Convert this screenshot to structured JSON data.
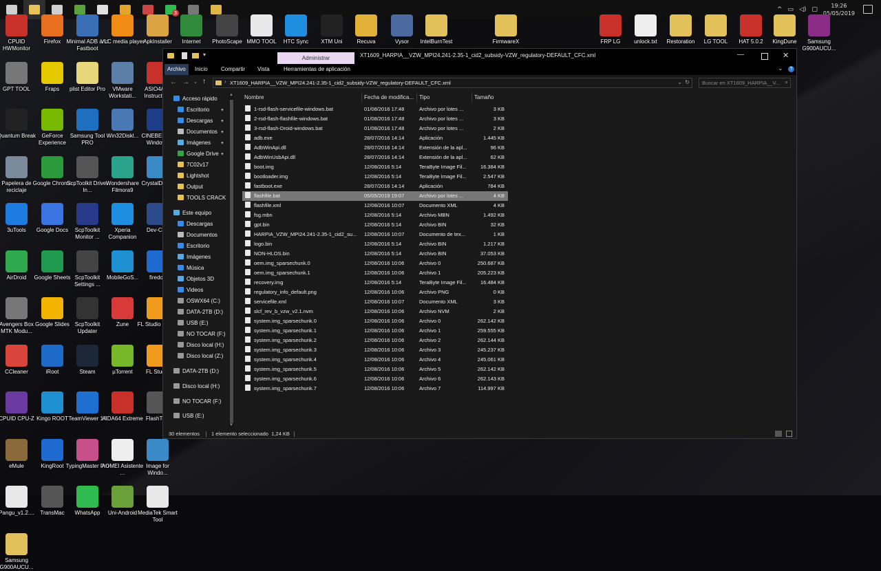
{
  "taskbar": {
    "time": "19:26",
    "date": "05/05/2019",
    "buttons": [
      {
        "icon": "windows-icon",
        "color": "#cfcfcf"
      },
      {
        "icon": "file-explorer-icon",
        "color": "#e8c25a"
      },
      {
        "icon": "store-icon",
        "color": "#cfcfcf"
      },
      {
        "icon": "app-green-icon",
        "color": "#5aa33c"
      },
      {
        "icon": "mail-icon",
        "color": "#e0e0e0"
      },
      {
        "icon": "chrome-icon",
        "color": "#e3a52b"
      },
      {
        "icon": "app-icon",
        "color": "#c44"
      },
      {
        "icon": "whatsapp-icon",
        "color": "#2fbb4f"
      },
      {
        "icon": "app-icon",
        "color": "#777"
      },
      {
        "icon": "app-icon",
        "color": "#e2b646"
      }
    ],
    "notification_badge": "3"
  },
  "desktop_icons": [
    {
      "label": "CPUID HWMonitor",
      "color": "#c8302a"
    },
    {
      "label": "Firefox",
      "color": "#e76f1e"
    },
    {
      "label": "Minimal ADB and Fastboot",
      "color": "#3b6fb5"
    },
    {
      "label": "VLC media player",
      "color": "#f08c14"
    },
    {
      "label": "ApkInstaller",
      "color": "#d9a441"
    },
    {
      "label": "Internet",
      "color": "#2f8a3c"
    },
    {
      "label": "PhotoScape",
      "color": "#444"
    },
    {
      "label": "MMO TOOL",
      "color": "#e8e8e8"
    },
    {
      "label": "HTC Sync",
      "color": "#1e8fe0"
    },
    {
      "label": "XTM Uni",
      "color": "#222"
    },
    {
      "label": "Recuva",
      "color": "#e2b13a"
    },
    {
      "label": "Vysor",
      "color": "#4a6aa0"
    },
    {
      "label": "IntelBurnTest",
      "color": "#e2c15a"
    },
    {
      "label": "FirmwareX",
      "color": "#e2c15a"
    },
    {
      "label": "FRP LG",
      "color": "#c8302a"
    },
    {
      "label": "unlock.txt",
      "color": "#eeeeee"
    },
    {
      "label": "Restoration",
      "color": "#e2c15a"
    },
    {
      "label": "LG TOOL",
      "color": "#e2c15a"
    },
    {
      "label": "HAT 5.0.2",
      "color": "#c8302a"
    },
    {
      "label": "KingDune",
      "color": "#e2c15a"
    },
    {
      "label": "Samsung G900AUCU...",
      "color": "#8b2d86"
    },
    {
      "label": "GPT TOOL",
      "color": "#777"
    },
    {
      "label": "Fraps",
      "color": "#e6c800"
    },
    {
      "label": "plist Editor Pro",
      "color": "#e8d77a"
    },
    {
      "label": "VMware Workstati...",
      "color": "#5b7fa6"
    },
    {
      "label": "ASIO4ALL Instructio...",
      "color": "#c8302a"
    },
    {
      "label": "Quantum Break",
      "color": "#222"
    },
    {
      "label": "GeForce Experience",
      "color": "#76b900"
    },
    {
      "label": "Samsung Tool PRO",
      "color": "#1e6fc0"
    },
    {
      "label": "Win32Diskl...",
      "color": "#4a78b5"
    },
    {
      "label": "CINEBENCH Windows",
      "color": "#1d3e86"
    },
    {
      "label": "Papelera de reciclaje",
      "color": "#7a8a9a"
    },
    {
      "label": "Google Chrome",
      "color": "#2a9a3c"
    },
    {
      "label": "ScpToolkit Driver In...",
      "color": "#555"
    },
    {
      "label": "Wondershare Filmora9",
      "color": "#2aa38a"
    },
    {
      "label": "CrystalDisk 6",
      "color": "#3a8ac8"
    },
    {
      "label": "3uTools",
      "color": "#1e7be0"
    },
    {
      "label": "Google Docs",
      "color": "#3a74e0"
    },
    {
      "label": "ScpToolkit Monitor ...",
      "color": "#2a3a8a"
    },
    {
      "label": "Xperia Companion",
      "color": "#1e8fe0"
    },
    {
      "label": "Dev-C++",
      "color": "#2a4a8a"
    },
    {
      "label": "AirDroid",
      "color": "#2fa84f"
    },
    {
      "label": "Google Sheets",
      "color": "#1f9a4e"
    },
    {
      "label": "ScpToolkit Settings ...",
      "color": "#444"
    },
    {
      "label": "MobileGoS...",
      "color": "#1e8fd0"
    },
    {
      "label": "firedoc",
      "color": "#1e6ad0"
    },
    {
      "label": "Avengers Box MTK Modu...",
      "color": "#777"
    },
    {
      "label": "Google Slides",
      "color": "#f2b400"
    },
    {
      "label": "ScpToolkit Updater",
      "color": "#333"
    },
    {
      "label": "Zune",
      "color": "#d83a3a"
    },
    {
      "label": "FL Studio (64bit)",
      "color": "#f09a1e"
    },
    {
      "label": "CCleaner",
      "color": "#d8453a"
    },
    {
      "label": "iRoot",
      "color": "#1e6ac8"
    },
    {
      "label": "Steam",
      "color": "#1b2838"
    },
    {
      "label": "µTorrent",
      "color": "#76b82a"
    },
    {
      "label": "FL Studio",
      "color": "#f09a1e"
    },
    {
      "label": "CPUID CPU-Z",
      "color": "#6a3aa0"
    },
    {
      "label": "Kingo ROOT",
      "color": "#1e8fd0"
    },
    {
      "label": "TeamViewer 14",
      "color": "#1e6fd0"
    },
    {
      "label": "AIDA64 Extreme",
      "color": "#c8302a"
    },
    {
      "label": "FlashTool",
      "color": "#555"
    },
    {
      "label": "eMule",
      "color": "#8a6a3a"
    },
    {
      "label": "KingRoot",
      "color": "#1e6ad0"
    },
    {
      "label": "TypingMaster Pro",
      "color": "#c8508a"
    },
    {
      "label": "AOMEI Asistente ...",
      "color": "#eeeeee"
    },
    {
      "label": "Image for Windo...",
      "color": "#3a8ac8"
    },
    {
      "label": "Pangu_v1.2....",
      "color": "#e8e8e8"
    },
    {
      "label": "TransMac",
      "color": "#555"
    },
    {
      "label": "WhatsApp",
      "color": "#2fbb4f"
    },
    {
      "label": "Uni-Android",
      "color": "#6aa03a"
    },
    {
      "label": "MediaTek Smart Tool",
      "color": "#e8e8e8"
    },
    {
      "label": "Samsung G900AUCU...",
      "color": "#e2c15a"
    }
  ],
  "explorer": {
    "title": "XT1609_HARPIA__VZW_MPI24.241-2.35-1_cid2_subsidy-VZW_regulatory-DEFAULT_CFC.xml",
    "context_tab": "Administrar",
    "ribbon_tabs": [
      "Archivo",
      "Inicio",
      "Compartir",
      "Vista",
      "Herramientas de aplicación"
    ],
    "address": "XT1609_HARPIA__VZW_MPI24.241-2.35-1_cid2_subsidy-VZW_regulatory-DEFAULT_CFC.xml",
    "search_placeholder": "Buscar en XT1609_HARPIA__V...",
    "nav_items": [
      {
        "label": "Acceso rápido",
        "indent": 0,
        "pin": false,
        "icon": "star-icon",
        "color": "#3a8ae0"
      },
      {
        "label": "Escritorio",
        "indent": 1,
        "pin": true,
        "icon": "desktop-icon",
        "color": "#3a8ae0"
      },
      {
        "label": "Descargas",
        "indent": 1,
        "pin": true,
        "icon": "download-icon",
        "color": "#3a8ae0"
      },
      {
        "label": "Documentos",
        "indent": 1,
        "pin": true,
        "icon": "documents-icon",
        "color": "#bbbbbb"
      },
      {
        "label": "Imágenes",
        "indent": 1,
        "pin": true,
        "icon": "pictures-icon",
        "color": "#5aaae0"
      },
      {
        "label": "Google Drive",
        "indent": 1,
        "pin": true,
        "icon": "drive-icon",
        "color": "#3aa04a"
      },
      {
        "label": "7C02v17",
        "indent": 1,
        "pin": false,
        "icon": "folder-icon",
        "color": "#e2c15a"
      },
      {
        "label": "Lightshot",
        "indent": 1,
        "pin": false,
        "icon": "folder-icon",
        "color": "#e2c15a"
      },
      {
        "label": "Output",
        "indent": 1,
        "pin": false,
        "icon": "folder-icon",
        "color": "#e2c15a"
      },
      {
        "label": "TOOLS CRACK",
        "indent": 1,
        "pin": false,
        "icon": "folder-icon",
        "color": "#e2c15a"
      },
      {
        "label": "Este equipo",
        "indent": 0,
        "pin": false,
        "icon": "computer-icon",
        "color": "#5aaae0"
      },
      {
        "label": "Descargas",
        "indent": 1,
        "pin": false,
        "icon": "download-icon",
        "color": "#3a8ae0"
      },
      {
        "label": "Documentos",
        "indent": 1,
        "pin": false,
        "icon": "documents-icon",
        "color": "#bbbbbb"
      },
      {
        "label": "Escritorio",
        "indent": 1,
        "pin": false,
        "icon": "desktop-icon",
        "color": "#3a8ae0"
      },
      {
        "label": "Imágenes",
        "indent": 1,
        "pin": false,
        "icon": "pictures-icon",
        "color": "#5aaae0"
      },
      {
        "label": "Música",
        "indent": 1,
        "pin": false,
        "icon": "music-icon",
        "color": "#3a8ae0"
      },
      {
        "label": "Objetos 3D",
        "indent": 1,
        "pin": false,
        "icon": "objects-3d-icon",
        "color": "#5aaae0"
      },
      {
        "label": "Videos",
        "indent": 1,
        "pin": false,
        "icon": "videos-icon",
        "color": "#3a8ae0"
      },
      {
        "label": "OSWX64 (C:)",
        "indent": 1,
        "pin": false,
        "icon": "drive-icon",
        "color": "#999999"
      },
      {
        "label": "DATA-2TB (D:)",
        "indent": 1,
        "pin": false,
        "icon": "drive-icon",
        "color": "#999999"
      },
      {
        "label": "USB (E:)",
        "indent": 1,
        "pin": false,
        "icon": "drive-icon",
        "color": "#999999"
      },
      {
        "label": "NO TOCAR (F:)",
        "indent": 1,
        "pin": false,
        "icon": "drive-icon",
        "color": "#999999"
      },
      {
        "label": "Disco local (H:)",
        "indent": 1,
        "pin": false,
        "icon": "drive-icon",
        "color": "#999999"
      },
      {
        "label": "Disco local (Z:)",
        "indent": 1,
        "pin": false,
        "icon": "drive-icon",
        "color": "#999999"
      },
      {
        "label": "DATA-2TB (D:)",
        "indent": 0,
        "pin": false,
        "icon": "drive-icon",
        "color": "#999999"
      },
      {
        "label": "Disco local (H:)",
        "indent": 0,
        "pin": false,
        "icon": "drive-icon",
        "color": "#999999"
      },
      {
        "label": "NO TOCAR (F:)",
        "indent": 0,
        "pin": false,
        "icon": "drive-icon",
        "color": "#999999"
      },
      {
        "label": "USB (E:)",
        "indent": 0,
        "pin": false,
        "icon": "drive-icon",
        "color": "#999999"
      }
    ],
    "columns": [
      "Nombre",
      "Fecha de modifica...",
      "Tipo",
      "Tamaño"
    ],
    "files": [
      {
        "name": "1-rsd-flash-servicefile-windows.bat",
        "date": "01/08/2016 17:48",
        "type": "Archivo por lotes ...",
        "size": "3 KB",
        "icon": "bat-file-icon"
      },
      {
        "name": "2-rsd-flash-flashfile-windows.bat",
        "date": "01/08/2016 17:48",
        "type": "Archivo por lotes ...",
        "size": "3 KB",
        "icon": "bat-file-icon"
      },
      {
        "name": "3-rsd-flash-Droid-windows.bat",
        "date": "01/08/2016 17:48",
        "type": "Archivo por lotes ...",
        "size": "2 KB",
        "icon": "bat-file-icon"
      },
      {
        "name": "adb.exe",
        "date": "28/07/2016 14:14",
        "type": "Aplicación",
        "size": "1.445 KB",
        "icon": "exe-file-icon"
      },
      {
        "name": "AdbWinApi.dll",
        "date": "28/07/2016 14:14",
        "type": "Extensión de la apl...",
        "size": "96 KB",
        "icon": "dll-file-icon"
      },
      {
        "name": "AdbWinUsbApi.dll",
        "date": "28/07/2016 14:14",
        "type": "Extensión de la apl...",
        "size": "62 KB",
        "icon": "dll-file-icon"
      },
      {
        "name": "boot.img",
        "date": "12/08/2016 5:14",
        "type": "TeraByte Image Fil...",
        "size": "16.384 KB",
        "icon": "img-file-icon"
      },
      {
        "name": "bootloader.img",
        "date": "12/08/2016 5:14",
        "type": "TeraByte Image Fil...",
        "size": "2.547 KB",
        "icon": "img-file-icon"
      },
      {
        "name": "fastboot.exe",
        "date": "28/07/2016 14:14",
        "type": "Aplicación",
        "size": "784 KB",
        "icon": "exe-file-icon"
      },
      {
        "name": "flashfile.bat",
        "date": "05/05/2019 19:07",
        "type": "Archivo por lotes ...",
        "size": "4 KB",
        "icon": "bat-file-icon",
        "selected": true
      },
      {
        "name": "flashfile.xml",
        "date": "12/08/2016 10:07",
        "type": "Documento XML",
        "size": "4 KB",
        "icon": "xml-file-icon"
      },
      {
        "name": "fsg.mbn",
        "date": "12/08/2016 5:14",
        "type": "Archivo MBN",
        "size": "1.492 KB",
        "icon": "file-icon"
      },
      {
        "name": "gpt.bin",
        "date": "12/08/2016 5:14",
        "type": "Archivo BIN",
        "size": "32 KB",
        "icon": "file-icon"
      },
      {
        "name": "HARPIA_VZW_MPI24.241-2.35-1_cid2_su...",
        "date": "12/08/2016 10:07",
        "type": "Documento de tex...",
        "size": "1 KB",
        "icon": "txt-file-icon"
      },
      {
        "name": "logo.bin",
        "date": "12/08/2016 5:14",
        "type": "Archivo BIN",
        "size": "1.217 KB",
        "icon": "file-icon"
      },
      {
        "name": "NON-HLOS.bin",
        "date": "12/08/2016 5:14",
        "type": "Archivo BIN",
        "size": "37.053 KB",
        "icon": "file-icon"
      },
      {
        "name": "oem.img_sparsechunk.0",
        "date": "12/08/2016 10:06",
        "type": "Archivo 0",
        "size": "250.687 KB",
        "icon": "file-icon"
      },
      {
        "name": "oem.img_sparsechunk.1",
        "date": "12/08/2016 10:06",
        "type": "Archivo 1",
        "size": "205.223 KB",
        "icon": "file-icon"
      },
      {
        "name": "recovery.img",
        "date": "12/08/2016 5:14",
        "type": "TeraByte Image Fil...",
        "size": "16.484 KB",
        "icon": "img-file-icon"
      },
      {
        "name": "regulatory_info_default.png",
        "date": "12/08/2016 10:06",
        "type": "Archivo PNG",
        "size": "0 KB",
        "icon": "png-file-icon"
      },
      {
        "name": "servicefile.xml",
        "date": "12/08/2016 10:07",
        "type": "Documento XML",
        "size": "3 KB",
        "icon": "xml-file-icon"
      },
      {
        "name": "slcf_rev_b_vzw_v2.1.nvm",
        "date": "12/08/2016 10:06",
        "type": "Archivo NVM",
        "size": "2 KB",
        "icon": "file-icon"
      },
      {
        "name": "system.img_sparsechunk.0",
        "date": "12/08/2016 10:06",
        "type": "Archivo 0",
        "size": "262.142 KB",
        "icon": "file-icon"
      },
      {
        "name": "system.img_sparsechunk.1",
        "date": "12/08/2016 10:06",
        "type": "Archivo 1",
        "size": "259.555 KB",
        "icon": "file-icon"
      },
      {
        "name": "system.img_sparsechunk.2",
        "date": "12/08/2016 10:06",
        "type": "Archivo 2",
        "size": "262.144 KB",
        "icon": "file-icon"
      },
      {
        "name": "system.img_sparsechunk.3",
        "date": "12/08/2016 10:06",
        "type": "Archivo 3",
        "size": "245.237 KB",
        "icon": "file-icon"
      },
      {
        "name": "system.img_sparsechunk.4",
        "date": "12/08/2016 10:06",
        "type": "Archivo 4",
        "size": "245.061 KB",
        "icon": "file-icon"
      },
      {
        "name": "system.img_sparsechunk.5",
        "date": "12/08/2016 10:06",
        "type": "Archivo 5",
        "size": "262.142 KB",
        "icon": "file-icon"
      },
      {
        "name": "system.img_sparsechunk.6",
        "date": "12/08/2016 10:06",
        "type": "Archivo 6",
        "size": "262.143 KB",
        "icon": "file-icon"
      },
      {
        "name": "system.img_sparsechunk.7",
        "date": "12/08/2016 10:06",
        "type": "Archivo 7",
        "size": "114.997 KB",
        "icon": "file-icon"
      }
    ],
    "status": {
      "count": "30 elementos",
      "selection": "1 elemento seleccionado  1,24 KB"
    },
    "accent": "#3b3b3b",
    "context_tab_color": "#e9d7f2"
  }
}
